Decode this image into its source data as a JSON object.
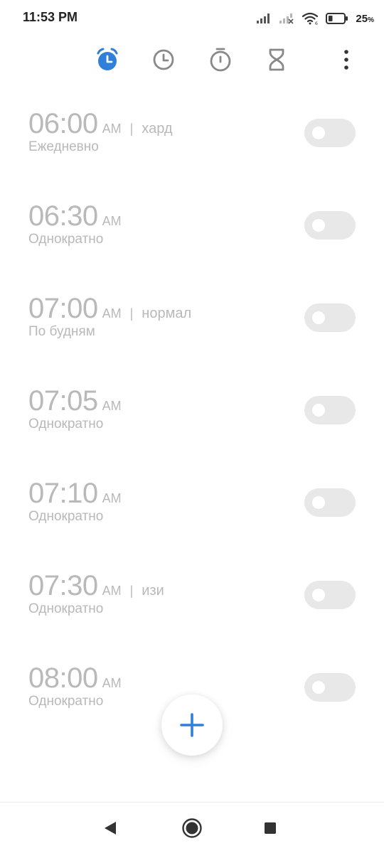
{
  "status_bar": {
    "time": "11:53 PM",
    "battery_value": "25",
    "battery_unit": "%",
    "battery_level": 0.25
  },
  "tabs": [
    {
      "id": "alarm",
      "icon": "alarm-icon",
      "active": true
    },
    {
      "id": "clock",
      "icon": "clock-icon",
      "active": false
    },
    {
      "id": "stopwatch",
      "icon": "stopwatch-icon",
      "active": false
    },
    {
      "id": "timer",
      "icon": "hourglass-icon",
      "active": false
    },
    {
      "id": "more",
      "icon": "more-vertical-icon",
      "active": false
    }
  ],
  "alarms": [
    {
      "time": "06:00",
      "ampm": "AM",
      "label": "хард",
      "repeat": "Ежедневно",
      "enabled": false
    },
    {
      "time": "06:30",
      "ampm": "AM",
      "label": "",
      "repeat": "Однократно",
      "enabled": false
    },
    {
      "time": "07:00",
      "ampm": "AM",
      "label": "нормал",
      "repeat": "По будням",
      "enabled": false
    },
    {
      "time": "07:05",
      "ampm": "AM",
      "label": "",
      "repeat": "Однократно",
      "enabled": false
    },
    {
      "time": "07:10",
      "ampm": "AM",
      "label": "",
      "repeat": "Однократно",
      "enabled": false
    },
    {
      "time": "07:30",
      "ampm": "AM",
      "label": "изи",
      "repeat": "Однократно",
      "enabled": false
    },
    {
      "time": "08:00",
      "ampm": "AM",
      "label": "",
      "repeat": "Однократно",
      "enabled": false
    }
  ],
  "label_separator": "|",
  "fab": {
    "icon": "plus-icon"
  },
  "nav_bar": {
    "back_icon": "back-triangle-icon",
    "home_icon": "home-circle-icon",
    "recents_icon": "recents-square-icon"
  },
  "colors": {
    "accent": "#2f7fdb",
    "icon_gray": "#888888",
    "disabled_text": "#b9b9b9",
    "toggle_off": "#e8e8e8",
    "nav_icon": "#333333"
  }
}
